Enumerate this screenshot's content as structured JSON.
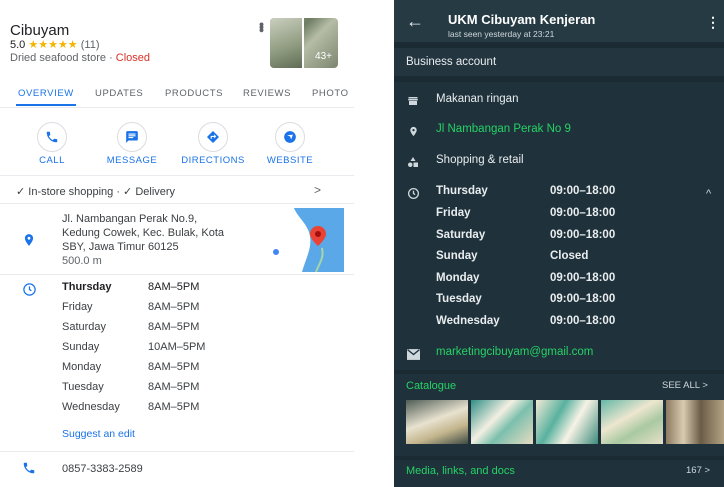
{
  "maps": {
    "title": "Cibuyam",
    "rating": "5.0",
    "stars": "★★★★★",
    "reviews": "(11)",
    "category": "Dried seafood store",
    "separator": "·",
    "status": "Closed",
    "photo_count": "43+",
    "tabs": [
      "OVERVIEW",
      "UPDATES",
      "PRODUCTS",
      "REVIEWS",
      "PHOTO"
    ],
    "actions": [
      {
        "label": "CALL",
        "icon": "phone-icon"
      },
      {
        "label": "MESSAGE",
        "icon": "message-icon"
      },
      {
        "label": "DIRECTIONS",
        "icon": "directions-icon"
      },
      {
        "label": "WEBSITE",
        "icon": "globe-icon"
      }
    ],
    "services": "✓ In-store shopping · ✓ Delivery",
    "address_line1": "Jl. Nambangan Perak No.9,",
    "address_line2": "Kedung Cowek, Kec. Bulak, Kota",
    "address_line3": "SBY, Jawa Timur 60125",
    "distance": "500.0 m",
    "hours": [
      {
        "day": "Thursday",
        "time": "8AM–5PM"
      },
      {
        "day": "Friday",
        "time": "8AM–5PM"
      },
      {
        "day": "Saturday",
        "time": "8AM–5PM"
      },
      {
        "day": "Sunday",
        "time": "10AM–5PM"
      },
      {
        "day": "Monday",
        "time": "8AM–5PM"
      },
      {
        "day": "Tuesday",
        "time": "8AM–5PM"
      },
      {
        "day": "Wednesday",
        "time": "8AM–5PM"
      }
    ],
    "suggest_edit": "Suggest an edit",
    "phone": "0857-3383-2589",
    "colors": {
      "accent": "#1a73e8",
      "closed": "#d93025",
      "star": "#f4b400"
    }
  },
  "wa": {
    "name": "UKM Cibuyam Kenjeran",
    "last_seen": "last seen yesterday at 23:21",
    "business_account": "Business account",
    "category": "Makanan ringan",
    "address": "Jl Nambangan Perak No 9",
    "type": "Shopping & retail",
    "hours": [
      {
        "day": "Thursday",
        "time": "09:00–18:00"
      },
      {
        "day": "Friday",
        "time": "09:00–18:00"
      },
      {
        "day": "Saturday",
        "time": "09:00–18:00"
      },
      {
        "day": "Sunday",
        "time": "Closed"
      },
      {
        "day": "Monday",
        "time": "09:00–18:00"
      },
      {
        "day": "Tuesday",
        "time": "09:00–18:00"
      },
      {
        "day": "Wednesday",
        "time": "09:00–18:00"
      }
    ],
    "email": "marketingcibuyam@gmail.com",
    "catalogue": "Catalogue",
    "see_all": "SEE ALL >",
    "media": "Media, links, and docs",
    "media_count": "167 >",
    "colors": {
      "header": "#263a44",
      "background": "#1b2b33",
      "accent": "#25d366"
    }
  }
}
